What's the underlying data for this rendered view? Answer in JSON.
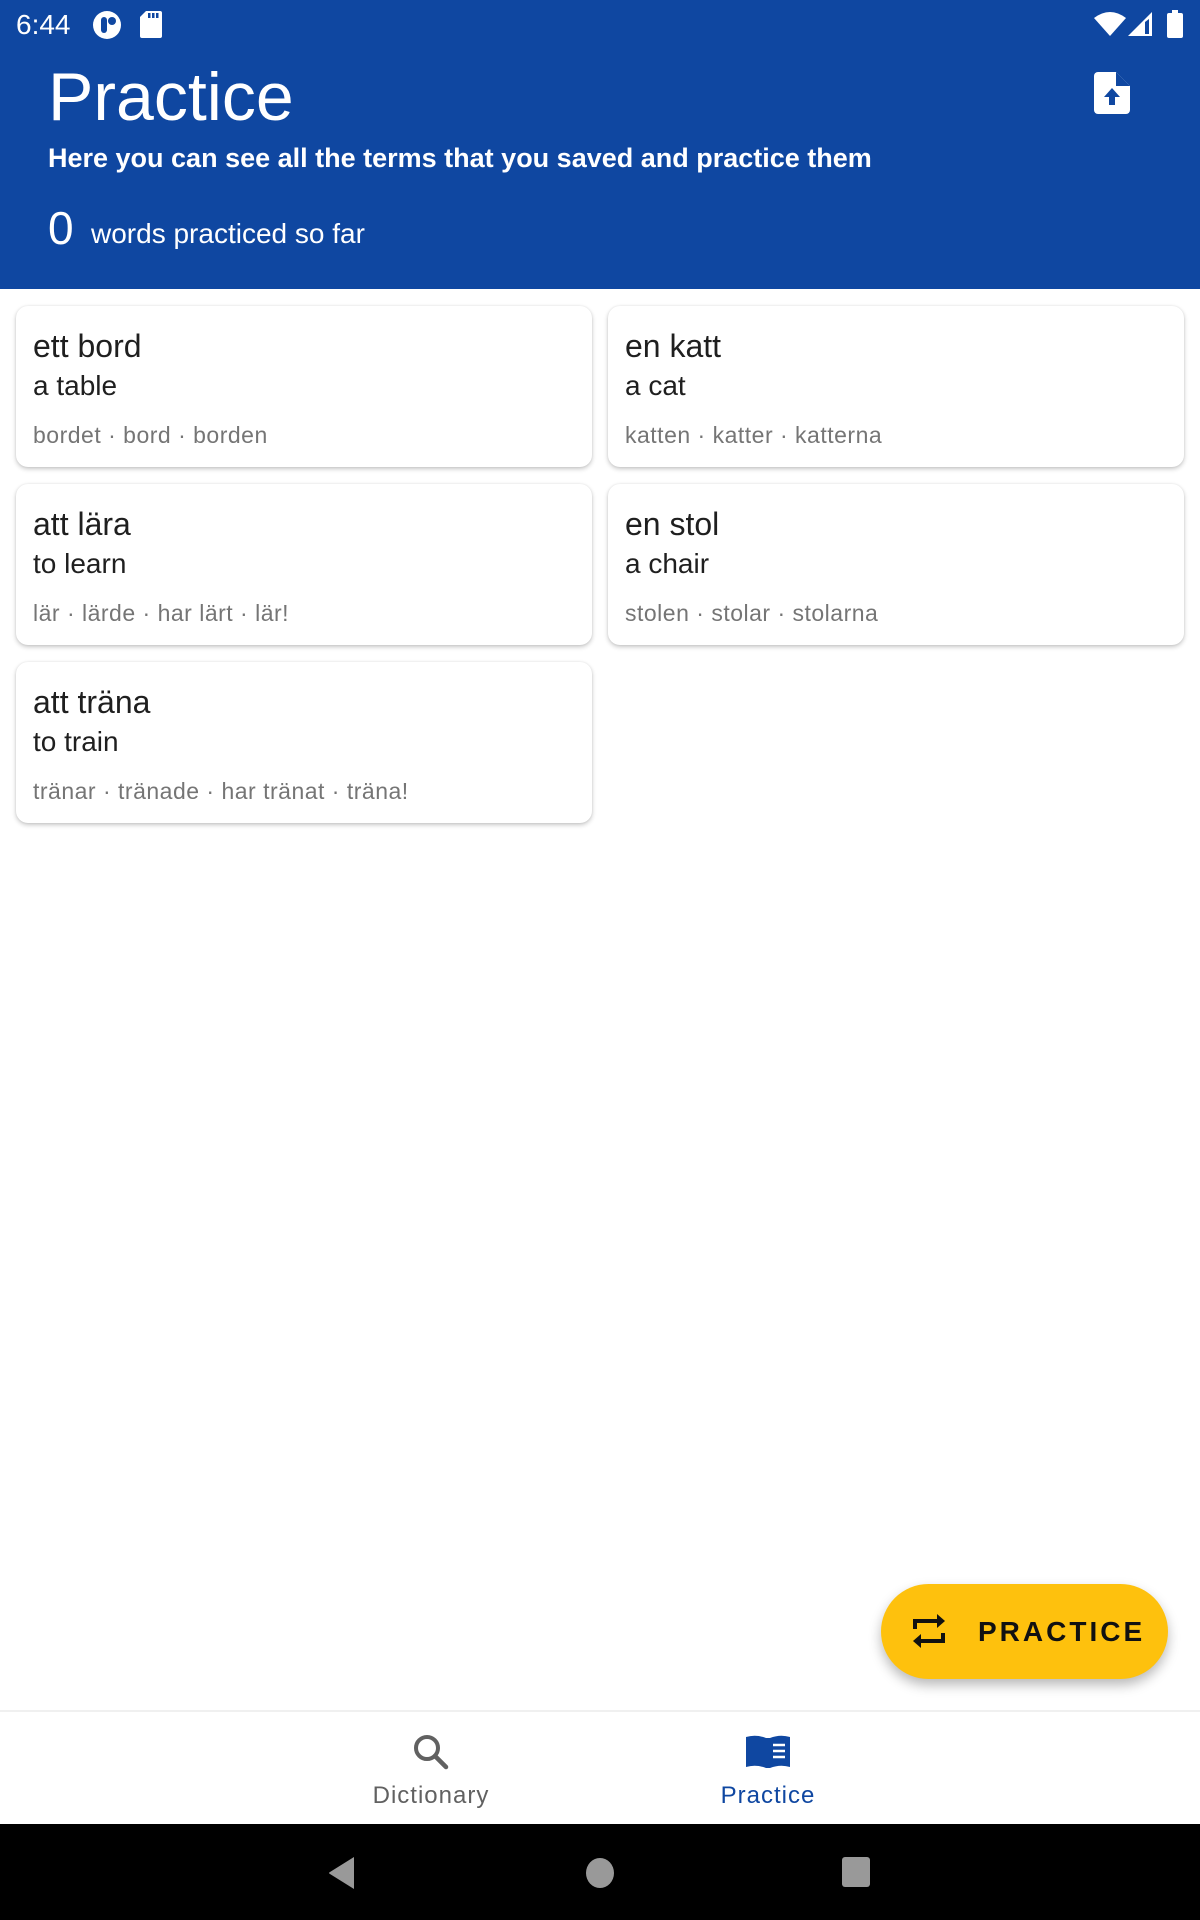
{
  "status_bar": {
    "time": "6:44",
    "left_icons": [
      "app-notification-icon",
      "sd-card-icon"
    ],
    "right_icons": [
      "wifi-icon",
      "cell-signal-icon",
      "battery-icon"
    ]
  },
  "header": {
    "title": "Practice",
    "subtitle": "Here you can see all the terms that you saved and practice them",
    "practiced_count": "0",
    "practiced_label": "words practiced so far",
    "export_icon": "file-upload-icon"
  },
  "cards": [
    {
      "term": "ett bord",
      "translation": "a table",
      "forms": "bordet · bord · borden"
    },
    {
      "term": "en katt",
      "translation": "a cat",
      "forms": "katten · katter · katterna"
    },
    {
      "term": "att lära",
      "translation": "to learn",
      "forms": "lär · lärde · har lärt · lär!"
    },
    {
      "term": "en stol",
      "translation": "a chair",
      "forms": "stolen · stolar · stolarna"
    },
    {
      "term": "att träna",
      "translation": "to train",
      "forms": "tränar · tränade · har tränat · träna!"
    }
  ],
  "fab": {
    "label": "PRACTICE",
    "icon": "repeat-icon"
  },
  "bottom_nav": {
    "items": [
      {
        "label": "Dictionary",
        "icon": "search-icon",
        "active": false
      },
      {
        "label": "Practice",
        "icon": "book-open-icon",
        "active": true
      }
    ]
  },
  "colors": {
    "primary": "#0f47a1",
    "accent": "#fec10d",
    "inactive_nav": "#616161",
    "secondary_text": "#757575"
  }
}
